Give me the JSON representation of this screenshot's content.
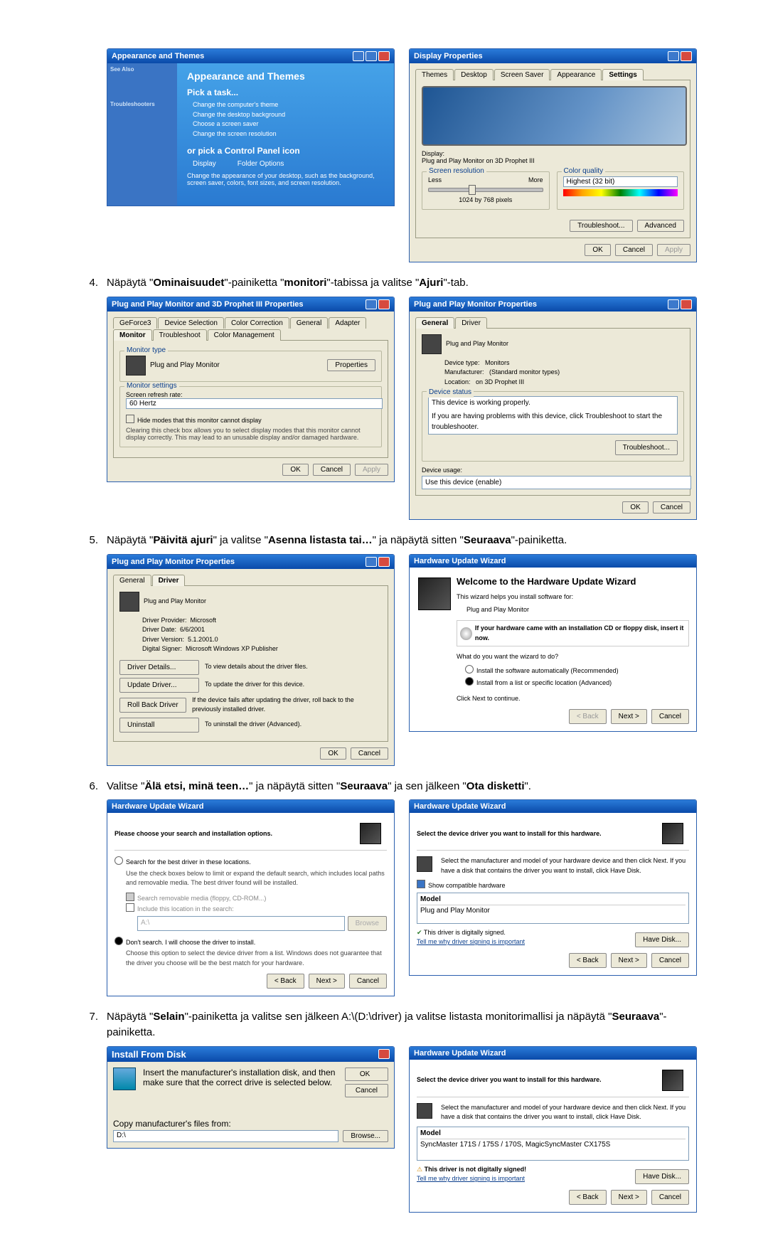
{
  "steps": {
    "s4": "Näpäytä \"Ominaisuudet\"-painiketta \"monitori\"-tabissa ja valitse \"Ajuri\"-tab.",
    "s5": "Näpäytä \"Päivitä ajuri\" ja valitse \"Asenna listasta tai…\" ja näpäytä sitten \"Seuraava\"-painiketta.",
    "s6": "Valitse \"Älä etsi, minä teen…\" ja näpäytä sitten \"Seuraava\" ja sen jälkeen \"Ota disketti\".",
    "s7": "Näpäytä \"Selain\"-painiketta ja valitse sen jälkeen A:\\(D:\\driver) ja valitse listasta monitorimallisi ja näpäytä \"Seuraava\"-painiketta."
  },
  "cp": {
    "title": "Appearance and Themes",
    "heading": "Appearance and Themes",
    "pick": "Pick a task...",
    "t1": "Change the computer's theme",
    "t2": "Change the desktop background",
    "t3": "Choose a screen saver",
    "t4": "Change the screen resolution",
    "or": "or pick a Control Panel icon",
    "icon1": "Display",
    "icon2": "Folder Options",
    "hint": "Change the appearance of your desktop, such as the background, screen saver, colors, font sizes, and screen resolution.",
    "side_see": "See Also",
    "side_ts": "Troubleshooters"
  },
  "disp": {
    "title": "Display Properties",
    "tabs": {
      "themes": "Themes",
      "desktop": "Desktop",
      "ss": "Screen Saver",
      "app": "Appearance",
      "settings": "Settings"
    },
    "display_lbl": "Display:",
    "display_val": "Plug and Play Monitor on 3D Prophet III",
    "res_lbl": "Screen resolution",
    "less": "Less",
    "more": "More",
    "res_val": "1024 by 768 pixels",
    "cq_lbl": "Color quality",
    "cq_val": "Highest (32 bit)",
    "ts": "Troubleshoot...",
    "adv": "Advanced",
    "ok": "OK",
    "cancel": "Cancel",
    "apply": "Apply"
  },
  "mon3d": {
    "title": "Plug and Play Monitor and 3D Prophet III Properties",
    "tabs": {
      "gf": "GeForce3",
      "ds": "Device Selection",
      "cc": "Color Correction",
      "gen": "General",
      "ad": "Adapter",
      "mon": "Monitor",
      "ts": "Troubleshoot",
      "cm": "Color Management"
    },
    "mt": "Monitor type",
    "pnp": "Plug and Play Monitor",
    "props": "Properties",
    "ms": "Monitor settings",
    "srr": "Screen refresh rate:",
    "hz": "60 Hertz",
    "hide": "Hide modes that this monitor cannot display",
    "note": "Clearing this check box allows you to select display modes that this monitor cannot display correctly. This may lead to an unusable display and/or damaged hardware.",
    "ok": "OK",
    "cancel": "Cancel",
    "apply": "Apply"
  },
  "monprops": {
    "title": "Plug and Play Monitor Properties",
    "tabs": {
      "gen": "General",
      "drv": "Driver"
    },
    "pnp": "Plug and Play Monitor",
    "dt": "Device type:",
    "dtv": "Monitors",
    "mf": "Manufacturer:",
    "mfv": "(Standard monitor types)",
    "loc": "Location:",
    "locv": "on 3D Prophet III",
    "ds": "Device status",
    "dsv": "This device is working properly.",
    "dshelp": "If you are having problems with this device, click Troubleshoot to start the troubleshooter.",
    "ts": "Troubleshoot...",
    "du": "Device usage:",
    "duv": "Use this device (enable)",
    "ok": "OK",
    "cancel": "Cancel"
  },
  "drvtab": {
    "title": "Plug and Play Monitor Properties",
    "pnp": "Plug and Play Monitor",
    "dp": "Driver Provider:",
    "dpv": "Microsoft",
    "dd": "Driver Date:",
    "ddv": "6/6/2001",
    "dv": "Driver Version:",
    "dvv": "5.1.2001.0",
    "ds": "Digital Signer:",
    "dsv": "Microsoft Windows XP Publisher",
    "b1": "Driver Details...",
    "b1d": "To view details about the driver files.",
    "b2": "Update Driver...",
    "b2d": "To update the driver for this device.",
    "b3": "Roll Back Driver",
    "b3d": "If the device fails after updating the driver, roll back to the previously installed driver.",
    "b4": "Uninstall",
    "b4d": "To uninstall the driver (Advanced).",
    "ok": "OK",
    "cancel": "Cancel"
  },
  "wiz1": {
    "title": "Hardware Update Wizard",
    "h": "Welcome to the Hardware Update Wizard",
    "p1": "This wizard helps you install software for:",
    "p1v": "Plug and Play Monitor",
    "p2": "If your hardware came with an installation CD or floppy disk, insert it now.",
    "q": "What do you want the wizard to do?",
    "o1": "Install the software automatically (Recommended)",
    "o2": "Install from a list or specific location (Advanced)",
    "cont": "Click Next to continue.",
    "back": "< Back",
    "next": "Next >",
    "cancel": "Cancel"
  },
  "wiz2": {
    "title": "Hardware Update Wizard",
    "h": "Please choose your search and installation options.",
    "o1": "Search for the best driver in these locations.",
    "o1d": "Use the check boxes below to limit or expand the default search, which includes local paths and removable media. The best driver found will be installed.",
    "c1": "Search removable media (floppy, CD-ROM...)",
    "c2": "Include this location in the search:",
    "loc": "A:\\",
    "browse": "Browse",
    "o2": "Don't search. I will choose the driver to install.",
    "o2d": "Choose this option to select the device driver from a list. Windows does not guarantee that the driver you choose will be the best match for your hardware.",
    "back": "< Back",
    "next": "Next >",
    "cancel": "Cancel"
  },
  "wiz3": {
    "title": "Hardware Update Wizard",
    "h": "Select the device driver you want to install for this hardware.",
    "p": "Select the manufacturer and model of your hardware device and then click Next. If you have a disk that contains the driver you want to install, click Have Disk.",
    "sch": "Show compatible hardware",
    "model": "Model",
    "mv": "Plug and Play Monitor",
    "signed": "This driver is digitally signed.",
    "tell": "Tell me why driver signing is important",
    "hd": "Have Disk...",
    "back": "< Back",
    "next": "Next >",
    "cancel": "Cancel"
  },
  "ifd": {
    "title": "Install From Disk",
    "p": "Insert the manufacturer's installation disk, and then make sure that the correct drive is selected below.",
    "ok": "OK",
    "cancel": "Cancel",
    "lbl": "Copy manufacturer's files from:",
    "val": "D:\\",
    "browse": "Browse..."
  },
  "wiz4": {
    "title": "Hardware Update Wizard",
    "h": "Select the device driver you want to install for this hardware.",
    "p": "Select the manufacturer and model of your hardware device and then click Next. If you have a disk that contains the driver you want to install, click Have Disk.",
    "model": "Model",
    "mv": "SyncMaster 171S / 175S / 170S, MagicSyncMaster CX175S",
    "warn": "This driver is not digitally signed!",
    "tell": "Tell me why driver signing is important",
    "hd": "Have Disk...",
    "back": "< Back",
    "next": "Next >",
    "cancel": "Cancel"
  }
}
